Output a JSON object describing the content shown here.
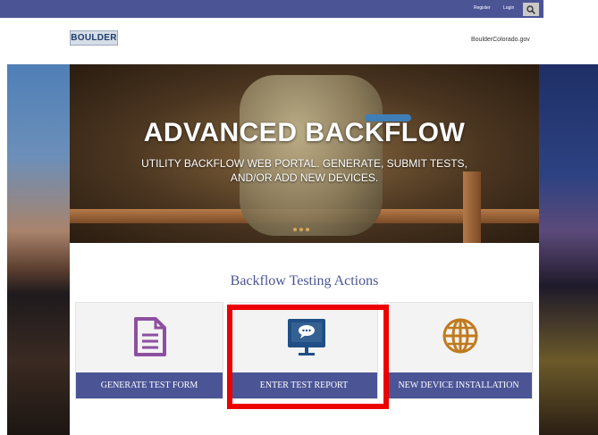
{
  "topbar": {
    "register": "Register",
    "login": "Login",
    "search_icon": "search-icon"
  },
  "header": {
    "logo_text": "BOULDER",
    "site_link": "BoulderColorado.gov"
  },
  "hero": {
    "title": "ADVANCED BACKFLOW",
    "subtitle_line1": "UTILITY BACKFLOW WEB PORTAL. GENERATE, SUBMIT TESTS,",
    "subtitle_line2": "AND/OR ADD NEW DEVICES."
  },
  "section": {
    "title": "Backflow Testing Actions"
  },
  "actions": [
    {
      "label": "GENERATE TEST FORM",
      "icon": "document-icon",
      "color": "#8e4fa0"
    },
    {
      "label": "ENTER TEST REPORT",
      "icon": "monitor-chat-icon",
      "color": "#1f4f86"
    },
    {
      "label": "NEW DEVICE INSTALLATION",
      "icon": "globe-icon",
      "color": "#c07a1e"
    }
  ],
  "colors": {
    "brand": "#4b5596",
    "highlight": "#ec0000"
  }
}
